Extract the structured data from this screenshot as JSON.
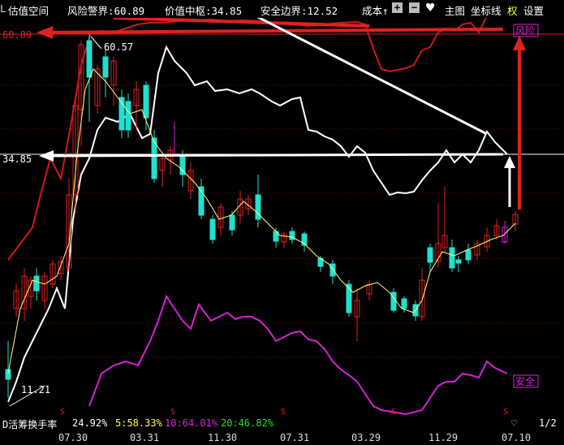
{
  "header": {
    "title": "估值空间",
    "risk_label": "风险警界:60.89",
    "value_label": "价值中枢:34.85",
    "safe_label": "安全边界:12.52",
    "cost_label": "成本↑",
    "add_icon": "plus-icon",
    "minus_icon": "minus-icon",
    "heart_icon": "heart-icon",
    "main_chart": "主图",
    "axis_line": "坐标线",
    "rights": "权",
    "settings": "设置"
  },
  "chart": {
    "risk_tag": "60.89",
    "value_tag": "34.85",
    "high_label": "60.57",
    "low_label": "11.21",
    "risk_badge": "风险",
    "safe_badge": "安全",
    "dividend_mark": "S"
  },
  "footer": {
    "indicator": "D活筹换手率",
    "v1": "24.92%",
    "v2": "5:58.33%",
    "v3": "10:64.01%",
    "v4": "20:46.82%",
    "clock_icon": "clock-icon",
    "page_info": "1/2"
  },
  "xaxis": [
    "07.30",
    "03.31",
    "11.30",
    "07.31",
    "03.29",
    "11.29",
    "07.10"
  ],
  "colors": {
    "risk": "#e02020",
    "value": "#ffffff",
    "safe": "#e020e0",
    "up": "#e02020",
    "down": "#20e0d0",
    "ma": "#ffff80",
    "v3": "#e020e0",
    "v4": "#20e020"
  }
}
